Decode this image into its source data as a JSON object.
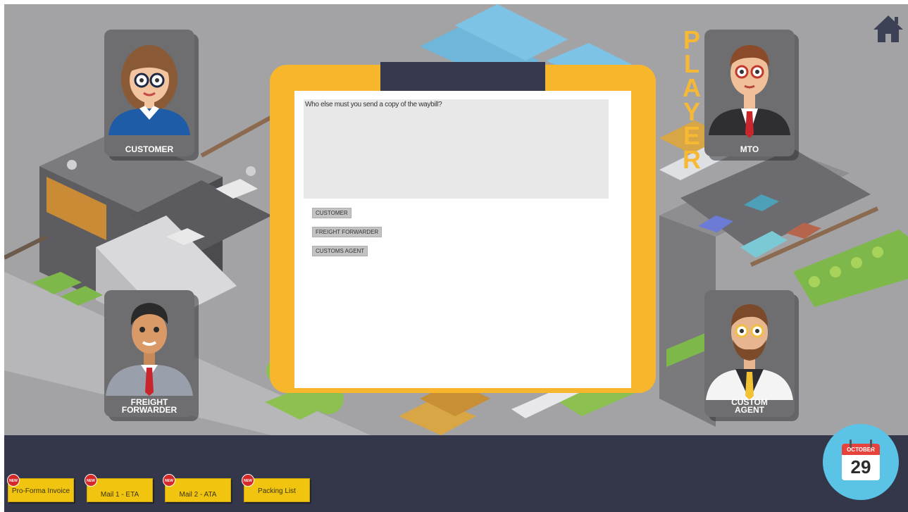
{
  "characters": {
    "customer": "CUSTOMER",
    "mto": "MTO",
    "freight_forwarder": "FREIGHT\nFORWARDER",
    "custom_agent": "CUSTOM\nAGENT"
  },
  "player_label": [
    "P",
    "L",
    "A",
    "Y",
    "E",
    "R"
  ],
  "question": {
    "text": "Who else must you send a copy of the waybill?",
    "answers": [
      "CUSTOMER",
      "FREIGHT FORWARDER",
      "CUSTOMS AGENT"
    ]
  },
  "documents": [
    {
      "label": "Pro-Forma Invoice",
      "badge": "NEW"
    },
    {
      "label": "Mail 1 - ETA",
      "badge": "NEW"
    },
    {
      "label": "Mail 2 - ATA",
      "badge": "NEW"
    },
    {
      "label": "Packing List",
      "badge": "NEW"
    }
  ],
  "calendar": {
    "month": "OCTOBER",
    "day": "29"
  },
  "icons": {
    "home": "home-icon",
    "calendar": "calendar-icon",
    "badge": "new-badge-icon"
  },
  "colors": {
    "accent": "#f8b62c",
    "taskbar": "#343649",
    "doc_button": "#f1c40f",
    "badge": "#d62828",
    "calendar": "#5bc4e6"
  }
}
